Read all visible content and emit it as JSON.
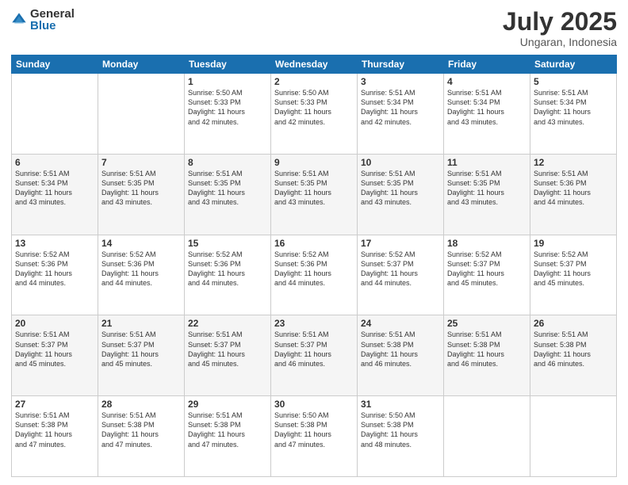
{
  "header": {
    "logo_general": "General",
    "logo_blue": "Blue",
    "month": "July 2025",
    "location": "Ungaran, Indonesia"
  },
  "weekdays": [
    "Sunday",
    "Monday",
    "Tuesday",
    "Wednesday",
    "Thursday",
    "Friday",
    "Saturday"
  ],
  "weeks": [
    [
      {
        "day": "",
        "info": ""
      },
      {
        "day": "",
        "info": ""
      },
      {
        "day": "1",
        "info": "Sunrise: 5:50 AM\nSunset: 5:33 PM\nDaylight: 11 hours\nand 42 minutes."
      },
      {
        "day": "2",
        "info": "Sunrise: 5:50 AM\nSunset: 5:33 PM\nDaylight: 11 hours\nand 42 minutes."
      },
      {
        "day": "3",
        "info": "Sunrise: 5:51 AM\nSunset: 5:34 PM\nDaylight: 11 hours\nand 42 minutes."
      },
      {
        "day": "4",
        "info": "Sunrise: 5:51 AM\nSunset: 5:34 PM\nDaylight: 11 hours\nand 43 minutes."
      },
      {
        "day": "5",
        "info": "Sunrise: 5:51 AM\nSunset: 5:34 PM\nDaylight: 11 hours\nand 43 minutes."
      }
    ],
    [
      {
        "day": "6",
        "info": "Sunrise: 5:51 AM\nSunset: 5:34 PM\nDaylight: 11 hours\nand 43 minutes."
      },
      {
        "day": "7",
        "info": "Sunrise: 5:51 AM\nSunset: 5:35 PM\nDaylight: 11 hours\nand 43 minutes."
      },
      {
        "day": "8",
        "info": "Sunrise: 5:51 AM\nSunset: 5:35 PM\nDaylight: 11 hours\nand 43 minutes."
      },
      {
        "day": "9",
        "info": "Sunrise: 5:51 AM\nSunset: 5:35 PM\nDaylight: 11 hours\nand 43 minutes."
      },
      {
        "day": "10",
        "info": "Sunrise: 5:51 AM\nSunset: 5:35 PM\nDaylight: 11 hours\nand 43 minutes."
      },
      {
        "day": "11",
        "info": "Sunrise: 5:51 AM\nSunset: 5:35 PM\nDaylight: 11 hours\nand 43 minutes."
      },
      {
        "day": "12",
        "info": "Sunrise: 5:51 AM\nSunset: 5:36 PM\nDaylight: 11 hours\nand 44 minutes."
      }
    ],
    [
      {
        "day": "13",
        "info": "Sunrise: 5:52 AM\nSunset: 5:36 PM\nDaylight: 11 hours\nand 44 minutes."
      },
      {
        "day": "14",
        "info": "Sunrise: 5:52 AM\nSunset: 5:36 PM\nDaylight: 11 hours\nand 44 minutes."
      },
      {
        "day": "15",
        "info": "Sunrise: 5:52 AM\nSunset: 5:36 PM\nDaylight: 11 hours\nand 44 minutes."
      },
      {
        "day": "16",
        "info": "Sunrise: 5:52 AM\nSunset: 5:36 PM\nDaylight: 11 hours\nand 44 minutes."
      },
      {
        "day": "17",
        "info": "Sunrise: 5:52 AM\nSunset: 5:37 PM\nDaylight: 11 hours\nand 44 minutes."
      },
      {
        "day": "18",
        "info": "Sunrise: 5:52 AM\nSunset: 5:37 PM\nDaylight: 11 hours\nand 45 minutes."
      },
      {
        "day": "19",
        "info": "Sunrise: 5:52 AM\nSunset: 5:37 PM\nDaylight: 11 hours\nand 45 minutes."
      }
    ],
    [
      {
        "day": "20",
        "info": "Sunrise: 5:51 AM\nSunset: 5:37 PM\nDaylight: 11 hours\nand 45 minutes."
      },
      {
        "day": "21",
        "info": "Sunrise: 5:51 AM\nSunset: 5:37 PM\nDaylight: 11 hours\nand 45 minutes."
      },
      {
        "day": "22",
        "info": "Sunrise: 5:51 AM\nSunset: 5:37 PM\nDaylight: 11 hours\nand 45 minutes."
      },
      {
        "day": "23",
        "info": "Sunrise: 5:51 AM\nSunset: 5:37 PM\nDaylight: 11 hours\nand 46 minutes."
      },
      {
        "day": "24",
        "info": "Sunrise: 5:51 AM\nSunset: 5:38 PM\nDaylight: 11 hours\nand 46 minutes."
      },
      {
        "day": "25",
        "info": "Sunrise: 5:51 AM\nSunset: 5:38 PM\nDaylight: 11 hours\nand 46 minutes."
      },
      {
        "day": "26",
        "info": "Sunrise: 5:51 AM\nSunset: 5:38 PM\nDaylight: 11 hours\nand 46 minutes."
      }
    ],
    [
      {
        "day": "27",
        "info": "Sunrise: 5:51 AM\nSunset: 5:38 PM\nDaylight: 11 hours\nand 47 minutes."
      },
      {
        "day": "28",
        "info": "Sunrise: 5:51 AM\nSunset: 5:38 PM\nDaylight: 11 hours\nand 47 minutes."
      },
      {
        "day": "29",
        "info": "Sunrise: 5:51 AM\nSunset: 5:38 PM\nDaylight: 11 hours\nand 47 minutes."
      },
      {
        "day": "30",
        "info": "Sunrise: 5:50 AM\nSunset: 5:38 PM\nDaylight: 11 hours\nand 47 minutes."
      },
      {
        "day": "31",
        "info": "Sunrise: 5:50 AM\nSunset: 5:38 PM\nDaylight: 11 hours\nand 48 minutes."
      },
      {
        "day": "",
        "info": ""
      },
      {
        "day": "",
        "info": ""
      }
    ]
  ]
}
